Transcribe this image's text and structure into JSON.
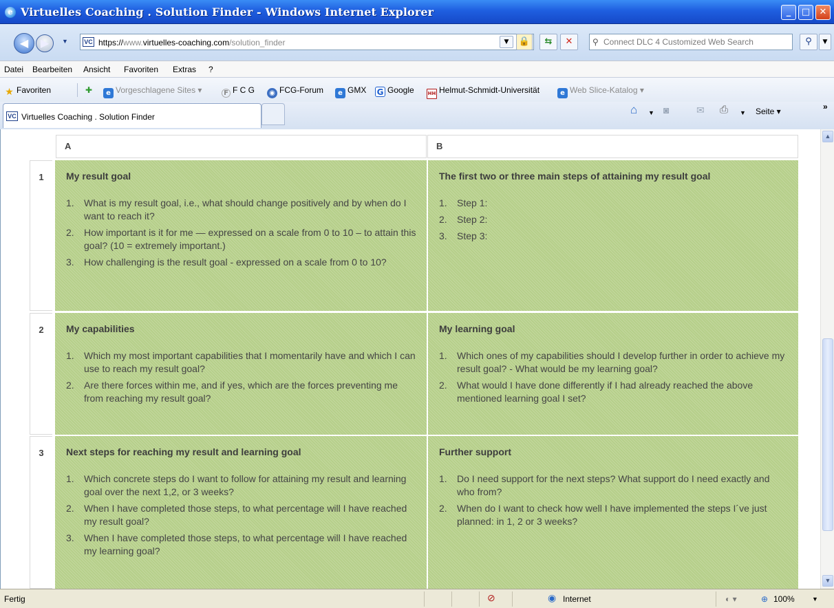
{
  "window": {
    "title": "Virtuelles Coaching . Solution Finder - Windows Internet Explorer",
    "minimize": "_",
    "maximize": "□",
    "close": "✕"
  },
  "address": {
    "favicon": "VC",
    "url_scheme": "https://",
    "url_host_pre": "www.",
    "url_host": "virtuelles-coaching.com",
    "url_path": "/solution_finder"
  },
  "search": {
    "placeholder": "Connect DLC 4 Customized Web Search"
  },
  "menu": [
    "Datei",
    "Bearbeiten",
    "Ansicht",
    "Favoriten",
    "Extras",
    "?"
  ],
  "favorites_bar": {
    "favorites_label": "Favoriten",
    "items": [
      {
        "label": "Vorgeschlagene Sites ▾",
        "icon": "ie-icon",
        "dim": true
      },
      {
        "label": "F C G",
        "icon": "f-icon",
        "dim": false
      },
      {
        "label": "FCG-Forum",
        "icon": "globe-icon",
        "dim": false
      },
      {
        "label": "GMX",
        "icon": "ie-icon",
        "dim": false
      },
      {
        "label": "Google",
        "icon": "google-icon",
        "dim": false
      },
      {
        "label": "Helmut-Schmidt-Universität",
        "icon": "hsu-icon",
        "dim": false
      },
      {
        "label": "Web Slice-Katalog ▾",
        "icon": "ie-icon",
        "dim": true
      }
    ]
  },
  "tab": {
    "favicon": "VC",
    "label": "Virtuelles Coaching . Solution Finder"
  },
  "command_bar": {
    "page_label": "Seite ▾",
    "more": "»"
  },
  "grid": {
    "col_a": "A",
    "col_b": "B",
    "rows": [
      {
        "num": "1",
        "a": {
          "title": "My result goal",
          "items": [
            "What is my result goal, i.e., what should change positively and by when do I want to reach it?",
            "How important is it for me — expressed on a scale from 0 to 10 – to attain this goal? (10 = extremely important.)",
            "How challenging is the result goal - expressed on a scale from 0 to 10?"
          ]
        },
        "b": {
          "title": "The first two or three main steps of attaining my result goal",
          "items": [
            "Step 1:",
            "Step 2:",
            "Step 3:"
          ]
        }
      },
      {
        "num": "2",
        "a": {
          "title": "My capabilities",
          "items": [
            "Which my most important capabilities that I momentarily have and which I can use to reach my result goal?",
            "Are there forces within me, and if yes, which are the forces preventing me from reaching my result goal?"
          ]
        },
        "b": {
          "title": "My learning goal",
          "items": [
            "Which ones of my capabilities should I develop further in order to achieve my result goal? - What would be my learning goal?",
            "What would I have done differently if I had already reached the above mentioned learning goal I set?"
          ]
        }
      },
      {
        "num": "3",
        "a": {
          "title": "Next steps for reaching my result and learning goal",
          "items": [
            "Which concrete steps do I want to follow for attaining my result and learning goal over the next 1,2, or 3 weeks?",
            "When I have completed those steps, to what percentage will I have reached my result goal?",
            "When I have completed those steps, to what percentage will I have reached my learning goal?"
          ]
        },
        "b": {
          "title": "Further support",
          "items": [
            "Do I need support for the next steps? What support do I need exactly and who from?",
            "When do I want to check how well I have implemented the steps I´ve just planned: in 1, 2 or 3 weeks?"
          ]
        }
      }
    ]
  },
  "status": {
    "text": "Fertig",
    "zone": "Internet",
    "zoom": "100%"
  },
  "colors": {
    "cell_green": "#b6cf8a",
    "title_blue": "#1f5fe0",
    "status_gray": "#ece9d8"
  }
}
